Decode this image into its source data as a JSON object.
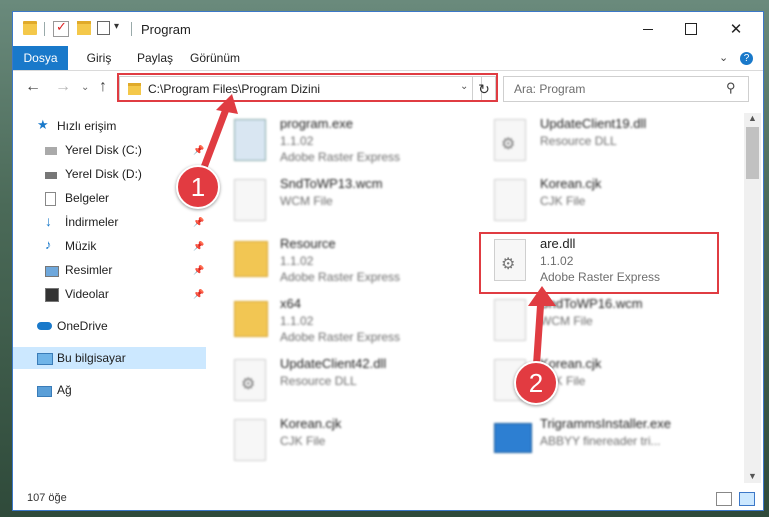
{
  "window": {
    "title": "Program"
  },
  "ribbon": {
    "tabs": [
      "Dosya",
      "Giriş",
      "Paylaş",
      "Görünüm"
    ]
  },
  "nav": {
    "address": "C:\\Program Files\\Program Dizini",
    "search_placeholder": "Ara: Program"
  },
  "sidebar": {
    "items": [
      {
        "label": "Hızlı erişim",
        "icon": "star-icon",
        "pinned": false
      },
      {
        "label": "Yerel Disk (C:)",
        "icon": "drive-icon",
        "pinned": true
      },
      {
        "label": "Yerel Disk (D:)",
        "icon": "drive-icon",
        "pinned": false
      },
      {
        "label": "Belgeler",
        "icon": "document-icon",
        "pinned": true
      },
      {
        "label": "İndirmeler",
        "icon": "download-icon",
        "pinned": true
      },
      {
        "label": "Müzik",
        "icon": "music-icon",
        "pinned": true
      },
      {
        "label": "Resimler",
        "icon": "image-icon",
        "pinned": true
      },
      {
        "label": "Videolar",
        "icon": "video-icon",
        "pinned": true
      },
      {
        "label": "OneDrive",
        "icon": "cloud-icon",
        "pinned": false
      },
      {
        "label": "Bu bilgisayar",
        "icon": "computer-icon",
        "pinned": false,
        "selected": true
      },
      {
        "label": "Ağ",
        "icon": "network-icon",
        "pinned": false
      }
    ]
  },
  "files": [
    {
      "name": "program.exe",
      "line2": "1.1.02",
      "line3": "Adobe Raster Express",
      "type": "exe"
    },
    {
      "name": "UpdateClient19.dll",
      "line2": "Resource DLL",
      "line3": "",
      "type": "dll"
    },
    {
      "name": "SndToWP13.wcm",
      "line2": "WCM File",
      "line3": "",
      "type": "file"
    },
    {
      "name": "Korean.cjk",
      "line2": "CJK File",
      "line3": "",
      "type": "file"
    },
    {
      "name": "Resource",
      "line2": "1.1.02",
      "line3": "Adobe Raster Express",
      "type": "folder"
    },
    {
      "name": "are.dll",
      "line2": "1.1.02",
      "line3": "Adobe Raster Express",
      "type": "dll",
      "highlighted": true
    },
    {
      "name": "x64",
      "line2": "1.1.02",
      "line3": "Adobe Raster Express",
      "type": "folder"
    },
    {
      "name": "SndToWP16.wcm",
      "line2": "WCM File",
      "line3": "",
      "type": "file"
    },
    {
      "name": "UpdateClient42.dll",
      "line2": "Resource DLL",
      "line3": "",
      "type": "dll"
    },
    {
      "name": "Korean.cjk",
      "line2": "CJK File",
      "line3": "",
      "type": "file"
    },
    {
      "name": "Korean.cjk",
      "line2": "CJK File",
      "line3": "",
      "type": "file"
    },
    {
      "name": "TrigrammsInstaller.exe",
      "line2": "ABBYY finereader tri...",
      "line3": "",
      "type": "app"
    }
  ],
  "status": {
    "count": "107 öğe"
  },
  "annotations": {
    "step1": "1",
    "step2": "2",
    "color": "#e03c42"
  }
}
